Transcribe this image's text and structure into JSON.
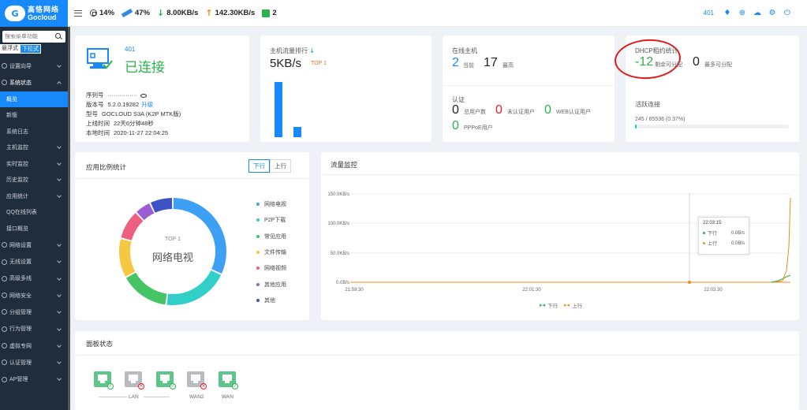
{
  "brand": {
    "cn": "高恪网络",
    "en": "Gocloud",
    "mark": "G"
  },
  "sidebar": {
    "search_placeholder": "搜索菜单功能",
    "mode_float": "悬浮式",
    "mode_dropdown": "下拉式",
    "items": [
      {
        "label": "设置向导",
        "type": "nav"
      },
      {
        "label": "系统状态",
        "type": "nav-open"
      },
      {
        "label": "概览",
        "type": "sub-active"
      },
      {
        "label": "新版",
        "type": "sub"
      },
      {
        "label": "系统日志",
        "type": "sub"
      },
      {
        "label": "主机监控",
        "type": "sub-chev"
      },
      {
        "label": "实时监控",
        "type": "sub-chev"
      },
      {
        "label": "历史监控",
        "type": "sub-chev"
      },
      {
        "label": "应用统计",
        "type": "sub-chev"
      },
      {
        "label": "QQ在线列表",
        "type": "sub"
      },
      {
        "label": "接口概览",
        "type": "sub"
      },
      {
        "label": "网络设置",
        "type": "nav"
      },
      {
        "label": "无线设置",
        "type": "nav"
      },
      {
        "label": "高级多线",
        "type": "nav"
      },
      {
        "label": "网络安全",
        "type": "nav"
      },
      {
        "label": "分组管理",
        "type": "nav"
      },
      {
        "label": "行为管理",
        "type": "nav"
      },
      {
        "label": "虚拟专网",
        "type": "nav"
      },
      {
        "label": "认证管理",
        "type": "nav"
      },
      {
        "label": "AP管理",
        "type": "nav"
      }
    ]
  },
  "header": {
    "cpu": "14%",
    "mem": "47%",
    "down": "8.00KB/s",
    "up": "142.30KB/s",
    "terminals": "2",
    "count": "401",
    "icons": [
      "shirt-icon",
      "globe-icon",
      "cloud-icon",
      "gear-icon",
      "power-icon"
    ]
  },
  "status": {
    "count": "401",
    "state": "已连接",
    "serial_label": "序列号",
    "serial_value": "···············",
    "version_label": "版本号",
    "version_value": "5.2.0.19282",
    "upgrade": "升级",
    "model_label": "型号",
    "model_value": "GOCLOUD S3A (K2P MTK版)",
    "uptime_label": "上线时间",
    "uptime_value": "22天6分钟48秒",
    "localtime_label": "本地时间",
    "localtime_value": "2020-11-27 22:04:25"
  },
  "flow": {
    "title": "主机流量排行",
    "value": "5KB/s",
    "top": "TOP 1",
    "bars": [
      1.0,
      0.19
    ]
  },
  "hosts": {
    "title": "在线主机",
    "current_value": "2",
    "current_label": "当前",
    "max_value": "17",
    "max_label": "最高",
    "auth_title": "认证",
    "total_value": "0",
    "total_label": "总用户数",
    "unauth_value": "0",
    "unauth_label": "未认证用户",
    "web_value": "0",
    "web_label": "WEB认证用户",
    "pppoe_value": "0",
    "pppoe_label": "PPPoE用户"
  },
  "dhcp": {
    "title": "DHCP租约统计",
    "remain_value": "-12",
    "remain_label": "剩余可分配",
    "max_value": "0",
    "max_label": "最多可分配",
    "conn_title": "活跃连接",
    "conn_value": "245 / 65536 (0.37%)",
    "conn_fraction": 0.0037
  },
  "app": {
    "title": "应用比例统计",
    "tab_down": "下行",
    "tab_up": "上行",
    "donut_top": "TOP 1",
    "donut_label": "网络电视",
    "segments": [
      {
        "name": "网络电视",
        "value": 32,
        "color": "#3ea0f5"
      },
      {
        "name": "P2P下载",
        "value": 20,
        "color": "#32cfc8"
      },
      {
        "name": "常见应用",
        "value": 15,
        "color": "#44c462"
      },
      {
        "name": "文件传输",
        "value": 12,
        "color": "#f5c842"
      },
      {
        "name": "网络视频",
        "value": 9,
        "color": "#ee5f80"
      },
      {
        "name": "其他应用",
        "value": 5,
        "color": "#9a5dd6"
      },
      {
        "name": "其他",
        "value": 7,
        "color": "#3d52c4"
      }
    ]
  },
  "traffic": {
    "title": "流量监控",
    "y_ticks": [
      "150.0KB/s",
      "100.0KB/s",
      "50.0KB/s",
      "0.0B/s"
    ],
    "x_ticks": [
      "21:59:30",
      "22:01:30",
      "22:03:30"
    ],
    "legend_down": "下行",
    "legend_up": "上行",
    "tooltip_time": "22:03:15",
    "tooltip_down_label": "下行",
    "tooltip_down_value": "0.0B/s",
    "tooltip_up_label": "上行",
    "tooltip_up_value": "0.0B/s",
    "colors": {
      "down": "#2bb24c",
      "up": "#f08c1f"
    }
  },
  "panel": {
    "title": "面板状态",
    "ports": [
      {
        "status": "up",
        "color": "#5ec68a"
      },
      {
        "status": "down",
        "color": "#b8bcc0"
      },
      {
        "status": "up",
        "color": "#5ec68a"
      },
      {
        "status": "down",
        "color": "#b8bcc0"
      },
      {
        "status": "up",
        "color": "#5ec68a"
      }
    ],
    "lan_label": "LAN",
    "wan2_label": "WAN2",
    "wan_label": "WAN"
  }
}
